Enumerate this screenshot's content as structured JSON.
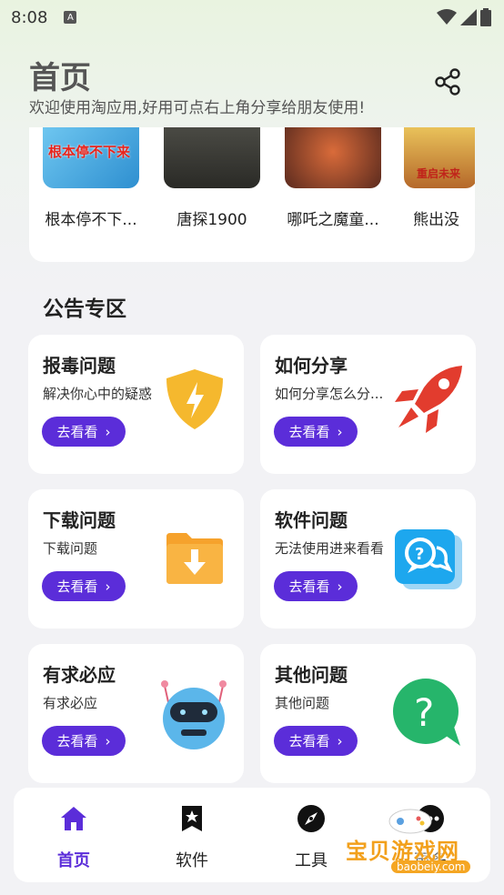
{
  "status": {
    "time": "8:08",
    "notif_badge": "A"
  },
  "header": {
    "title": "首页",
    "subtitle": "欢迎使用淘应用,好用可点右上角分享给朋友使用!"
  },
  "featured": {
    "items": [
      {
        "title": "根本停不下...",
        "poster_text": "根本停不下来"
      },
      {
        "title": "唐探1900"
      },
      {
        "title": "哪吒之魔童..."
      },
      {
        "title": "熊出没",
        "poster_text": "重启未来"
      }
    ]
  },
  "notices": {
    "section_title": "公告专区",
    "button_label": "去看看",
    "cards": [
      {
        "title": "报毒问题",
        "desc": "解决你心中的疑惑",
        "icon": "shield-bolt-icon"
      },
      {
        "title": "如何分享",
        "desc": "如何分享怎么分...",
        "icon": "rocket-icon"
      },
      {
        "title": "下载问题",
        "desc": "下载问题",
        "icon": "download-folder-icon"
      },
      {
        "title": "软件问题",
        "desc": "无法使用进来看看",
        "icon": "question-chat-icon"
      },
      {
        "title": "有求必应",
        "desc": "有求必应",
        "icon": "robot-icon"
      },
      {
        "title": "其他问题",
        "desc": "其他问题",
        "icon": "question-bubble-icon"
      }
    ]
  },
  "nav": {
    "items": [
      {
        "label": "首页",
        "icon": "home-icon",
        "active": true
      },
      {
        "label": "软件",
        "icon": "bookmark-star-icon"
      },
      {
        "label": "工具",
        "icon": "compass-icon"
      },
      {
        "label": "更多",
        "icon": "more-icon"
      }
    ]
  },
  "watermark": {
    "text": "宝贝游戏网",
    "url": "baobeiy.com"
  },
  "colors": {
    "accent": "#5b2dd9",
    "background": "#f2f2f5",
    "card": "#ffffff"
  }
}
